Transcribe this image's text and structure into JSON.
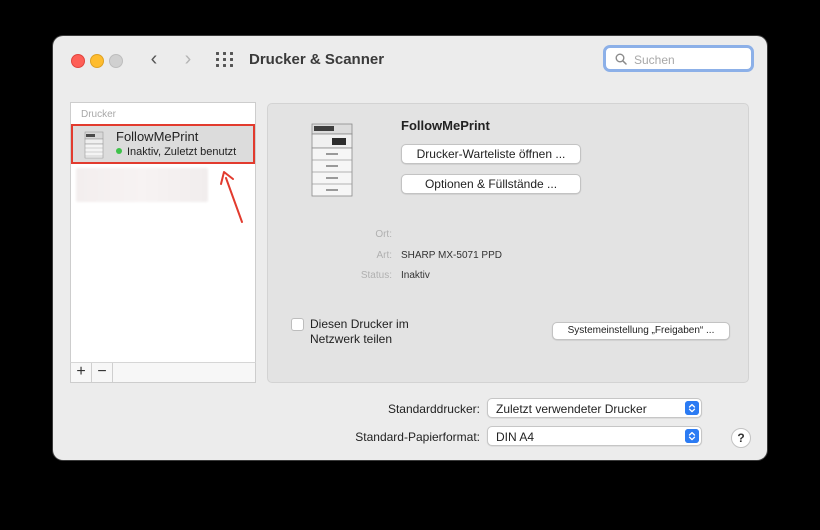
{
  "window": {
    "title": "Drucker & Scanner",
    "search": {
      "placeholder": "Suchen",
      "value": ""
    }
  },
  "sidebar": {
    "section_label": "Drucker",
    "printers": [
      {
        "name": "FollowMePrint",
        "status": "Inaktiv, Zuletzt benutzt",
        "selected": true
      }
    ],
    "add_label": "+",
    "remove_label": "−"
  },
  "details": {
    "name": "FollowMePrint",
    "queue_button": "Drucker-Warteliste öffnen ...",
    "options_button": "Optionen & Füllstände ...",
    "location_label": "Ort:",
    "location_value": "",
    "type_label": "Art:",
    "type_value": "SHARP MX-5071 PPD",
    "status_label": "Status:",
    "status_value": "Inaktiv",
    "share_label": "Diesen Drucker im Netzwerk teilen",
    "share_checked": false,
    "sys_prefs_button": "Systemeinstellung „Freigaben“ ..."
  },
  "defaults": {
    "printer_label": "Standarddrucker:",
    "printer_value": "Zuletzt verwendeter Drucker",
    "paper_label": "Standard-Papierformat:",
    "paper_value": "DIN A4"
  },
  "help_label": "?",
  "colors": {
    "highlight_border": "#e23b2e",
    "status_dot": "#3ec24a",
    "accent": "#2b7bf3",
    "search_focus": "#8cb0e8"
  }
}
